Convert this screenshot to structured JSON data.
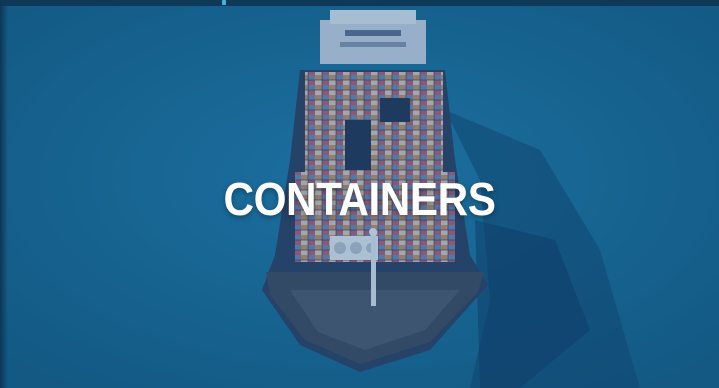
{
  "card": {
    "title": "CONTAINERS"
  },
  "colors": {
    "sea": "#1a6d98",
    "overlay": "#14568c",
    "title_text": "#ffffff",
    "top_indicator": "#5fd3ff"
  }
}
